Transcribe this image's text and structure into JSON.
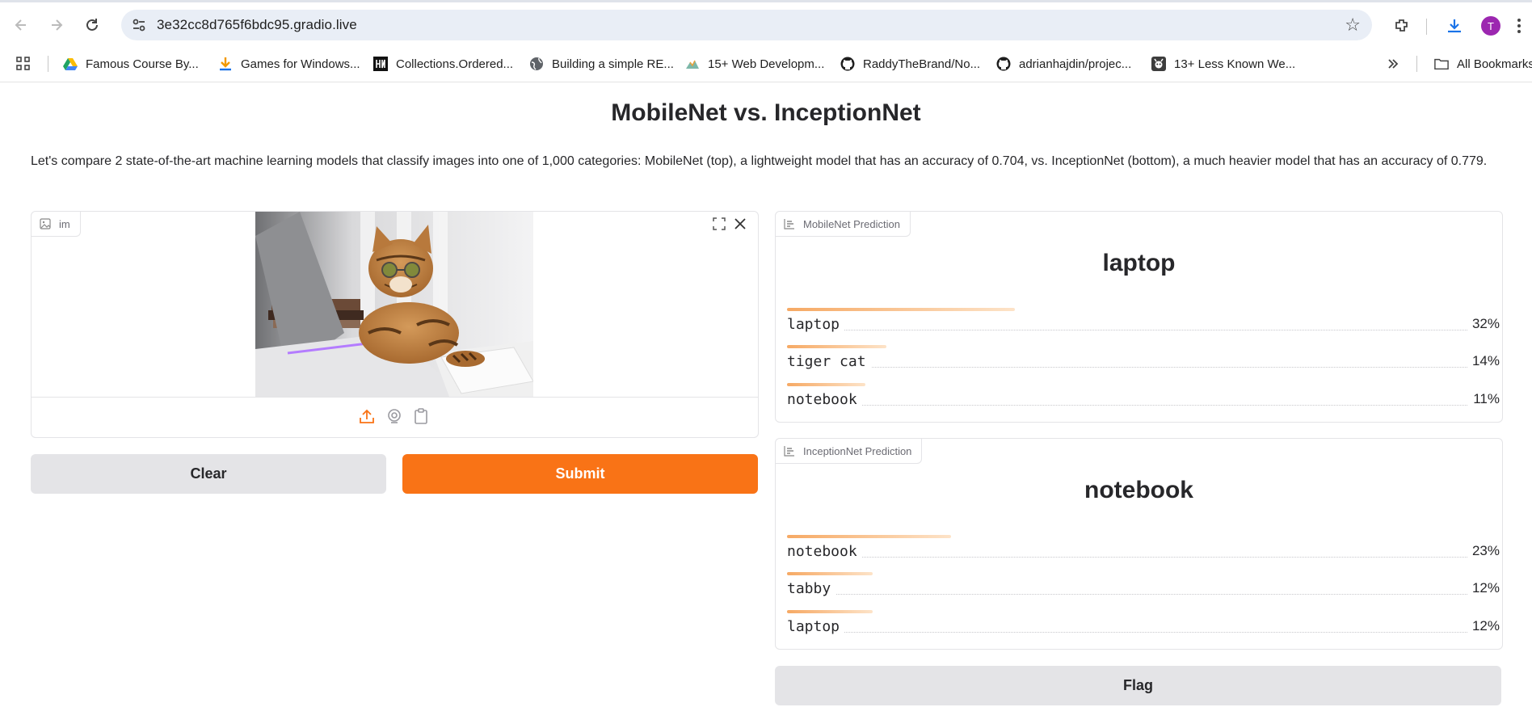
{
  "browser": {
    "url": "3e32cc8d765f6bdc95.gradio.live",
    "profile_initial": "T",
    "bookmarks": [
      {
        "label": "Famous Course By...",
        "icon": "google-drive-icon"
      },
      {
        "label": "Games for Windows...",
        "icon": "download-arrow-icon"
      },
      {
        "label": "Collections.Ordered...",
        "icon": "hn-logo-icon"
      },
      {
        "label": "Building a simple RE...",
        "icon": "globe-icon"
      },
      {
        "label": "15+ Web Developm...",
        "icon": "mountain-logo-icon"
      },
      {
        "label": "RaddyTheBrand/No...",
        "icon": "github-icon"
      },
      {
        "label": "adrianhajdin/projec...",
        "icon": "github-icon"
      },
      {
        "label": "13+ Less Known We...",
        "icon": "dev-logo-icon"
      }
    ],
    "all_bookmarks_label": "All Bookmarks"
  },
  "app": {
    "title": "MobileNet vs. InceptionNet",
    "description": "Let's compare 2 state-of-the-art machine learning models that classify images into one of 1,000 categories: MobileNet (top), a lightweight model that has an accuracy of 0.704, vs. InceptionNet (bottom), a much heavier model that has an accuracy of 0.779."
  },
  "image_input": {
    "label": "im",
    "image_alt": "cat wearing glasses with laptop"
  },
  "buttons": {
    "clear": "Clear",
    "submit": "Submit",
    "flag": "Flag"
  },
  "mobilenet": {
    "label": "MobileNet Prediction",
    "top": "laptop",
    "confidences": [
      {
        "label": "laptop",
        "pct": "32%",
        "value": 0.32
      },
      {
        "label": "tiger cat",
        "pct": "14%",
        "value": 0.14
      },
      {
        "label": "notebook",
        "pct": "11%",
        "value": 0.11
      }
    ]
  },
  "inceptionnet": {
    "label": "InceptionNet Prediction",
    "top": "notebook",
    "confidences": [
      {
        "label": "notebook",
        "pct": "23%",
        "value": 0.23
      },
      {
        "label": "tabby",
        "pct": "12%",
        "value": 0.12
      },
      {
        "label": "laptop",
        "pct": "12%",
        "value": 0.12
      }
    ]
  },
  "colors": {
    "primary": "#f97316",
    "secondary": "#e4e4e7",
    "bar_start": "#f6a964",
    "bar_end": "#fde3c8"
  }
}
